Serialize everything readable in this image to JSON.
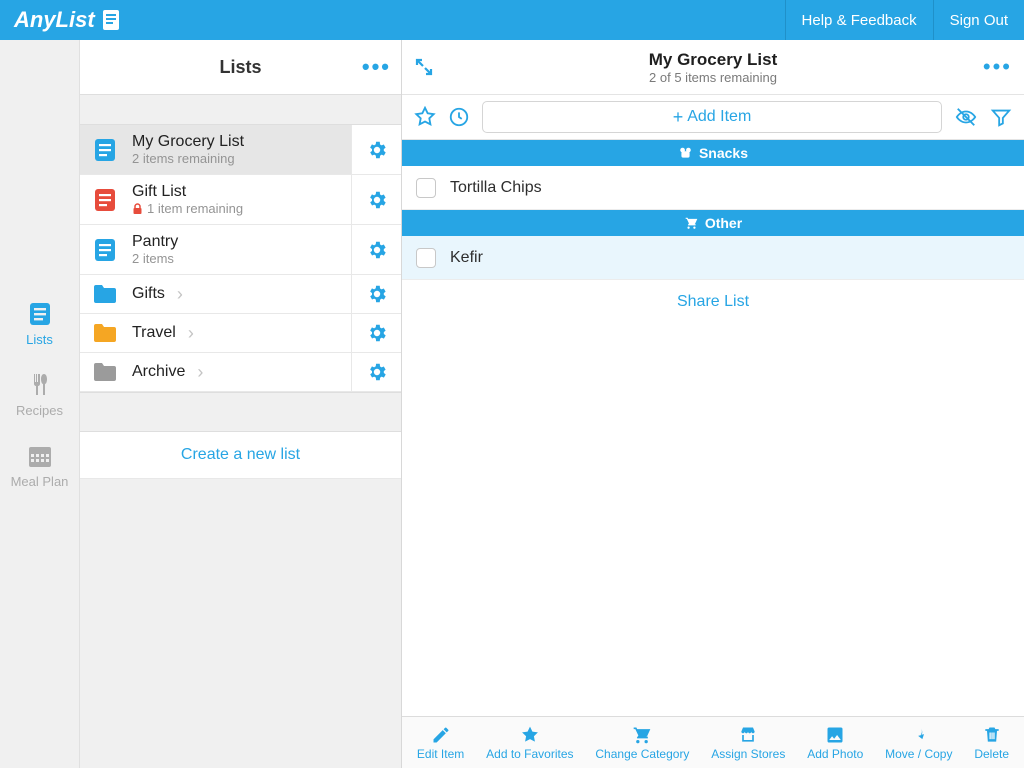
{
  "brand": "AnyList",
  "header_links": {
    "help": "Help & Feedback",
    "signout": "Sign Out"
  },
  "rail": {
    "lists": "Lists",
    "recipes": "Recipes",
    "mealplan": "Meal Plan"
  },
  "lists_panel": {
    "title": "Lists",
    "items": [
      {
        "name": "My Grocery List",
        "sub": "2 items remaining",
        "locked": false,
        "type": "list",
        "color": "#27a5e4",
        "selected": true
      },
      {
        "name": "Gift List",
        "sub": "1 item remaining",
        "locked": true,
        "type": "list",
        "color": "#e74c3c",
        "selected": false
      },
      {
        "name": "Pantry",
        "sub": "2 items",
        "locked": false,
        "type": "list",
        "color": "#27a5e4",
        "selected": false
      },
      {
        "name": "Gifts",
        "type": "folder",
        "color": "#27a5e4"
      },
      {
        "name": "Travel",
        "type": "folder",
        "color": "#f5a623"
      },
      {
        "name": "Archive",
        "type": "folder",
        "color": "#9b9b9b"
      }
    ],
    "create": "Create a new list"
  },
  "detail": {
    "title": "My Grocery List",
    "subtitle": "2 of 5 items remaining",
    "add_placeholder": "Add Item",
    "categories": [
      {
        "name": "Snacks",
        "icon": "pretzel",
        "items": [
          {
            "name": "Tortilla Chips",
            "selected": false
          }
        ]
      },
      {
        "name": "Other",
        "icon": "cart",
        "items": [
          {
            "name": "Kefir",
            "selected": true
          }
        ]
      }
    ],
    "share": "Share List"
  },
  "actions": {
    "edit": "Edit Item",
    "fav": "Add to Favorites",
    "category": "Change Category",
    "stores": "Assign Stores",
    "photo": "Add Photo",
    "move": "Move / Copy",
    "delete": "Delete"
  }
}
